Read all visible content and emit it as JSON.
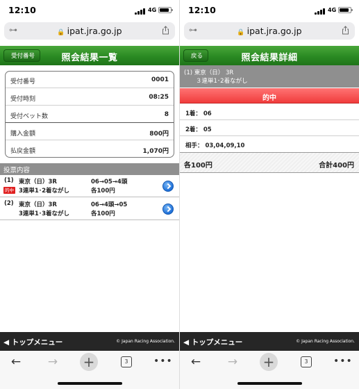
{
  "left": {
    "status": {
      "time": "12:10",
      "network": "4G"
    },
    "address": {
      "url": "ipat.jra.go.jp"
    },
    "header": {
      "back_label": "受付番号",
      "title": "照会結果一覧"
    },
    "summary": [
      {
        "label": "受付番号",
        "value": "0001"
      },
      {
        "label": "受付時刻",
        "value": "08:25"
      },
      {
        "label": "受付ベット数",
        "value": "8"
      },
      {
        "label": "購入金額",
        "value": "800円"
      },
      {
        "label": "払戻金額",
        "value": "1,070円"
      }
    ],
    "section_title": "投票内容",
    "bets": [
      {
        "num": "(1)",
        "race": "東京（日）3R",
        "type": "3連単1･2着ながし",
        "combo": "06→05→4頭",
        "amount": "各100円",
        "badge": "的中"
      },
      {
        "num": "(2)",
        "race": "東京（日）3R",
        "type": "3連単1･3着ながし",
        "combo": "06→4頭→05",
        "amount": "各100円",
        "badge": ""
      }
    ],
    "footer": {
      "menu": "◀ トップメニュー",
      "copyright": "© Japan Racing Association."
    },
    "toolbar": {
      "tab_count": "3"
    }
  },
  "right": {
    "status": {
      "time": "12:10",
      "network": "4G"
    },
    "address": {
      "url": "ipat.jra.go.jp"
    },
    "header": {
      "back_label": "戻る",
      "title": "照会結果詳細"
    },
    "detail": {
      "line1": "(1) 東京（日） 3R",
      "line2": "３連単1･2着ながし",
      "result": "的中",
      "rows": [
        "1着： 06",
        "2着： 05",
        "相手： 03,04,09,10"
      ],
      "unit_amount": "各100円",
      "total": "合計400円"
    },
    "footer": {
      "menu": "◀ トップメニュー",
      "copyright": "© Japan Racing Association."
    },
    "toolbar": {
      "tab_count": "3"
    }
  }
}
